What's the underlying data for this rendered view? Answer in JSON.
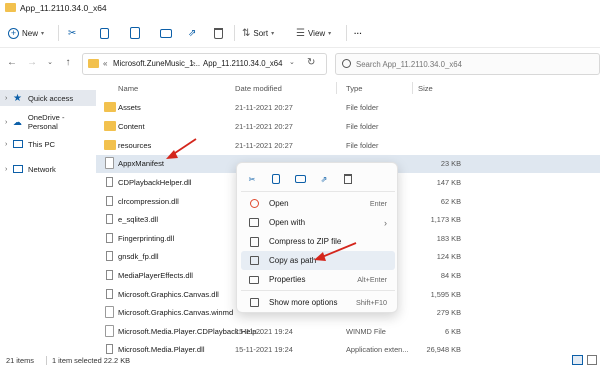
{
  "window": {
    "title": "App_11.2110.34.0_x64"
  },
  "toolbar": {
    "new_label": "New",
    "sort_label": "Sort",
    "view_label": "View",
    "more_label": "···"
  },
  "address": {
    "crumb_overflow": "«",
    "crumb1": "Microsoft.ZuneMusic_1...",
    "crumb_sep": ">",
    "crumb2": "App_11.2110.34.0_x64",
    "search_placeholder": "Search App_11.2110.34.0_x64"
  },
  "sidebar": {
    "items": [
      {
        "label": "Quick access"
      },
      {
        "label": "OneDrive - Personal"
      },
      {
        "label": "This PC"
      },
      {
        "label": "Network"
      }
    ]
  },
  "columns": {
    "name": "Name",
    "date": "Date modified",
    "type": "Type",
    "size": "Size"
  },
  "files": [
    {
      "name": "Assets",
      "date": "21-11-2021 20:27",
      "type": "File folder",
      "size": "",
      "kind": "folder"
    },
    {
      "name": "Content",
      "date": "21-11-2021 20:27",
      "type": "File folder",
      "size": "",
      "kind": "folder"
    },
    {
      "name": "resources",
      "date": "21-11-2021 20:27",
      "type": "File folder",
      "size": "",
      "kind": "folder"
    },
    {
      "name": "AppxManifest",
      "date": "",
      "type": "",
      "size": "23 KB",
      "kind": "file"
    },
    {
      "name": "CDPlaybackHelper.dll",
      "date": "",
      "type": "",
      "size": "147 KB",
      "kind": "dll"
    },
    {
      "name": "clrcompression.dll",
      "date": "",
      "type": "",
      "size": "62 KB",
      "kind": "dll"
    },
    {
      "name": "e_sqlite3.dll",
      "date": "",
      "type": "",
      "size": "1,173 KB",
      "kind": "dll"
    },
    {
      "name": "Fingerprinting.dll",
      "date": "",
      "type": "",
      "size": "183 KB",
      "kind": "dll"
    },
    {
      "name": "gnsdk_fp.dll",
      "date": "",
      "type": "",
      "size": "124 KB",
      "kind": "dll"
    },
    {
      "name": "MediaPlayerEffects.dll",
      "date": "",
      "type": "",
      "size": "84 KB",
      "kind": "dll"
    },
    {
      "name": "Microsoft.Graphics.Canvas.dll",
      "date": "",
      "type": "",
      "size": "1,595 KB",
      "kind": "dll"
    },
    {
      "name": "Microsoft.Graphics.Canvas.winmd",
      "date": "",
      "type": "",
      "size": "279 KB",
      "kind": "file"
    },
    {
      "name": "Microsoft.Media.Player.CDPlayback.Help...",
      "date": "15-11-2021 19:24",
      "type": "WINMD File",
      "size": "6 KB",
      "kind": "file"
    },
    {
      "name": "Microsoft.Media.Player.dll",
      "date": "15-11-2021 19:24",
      "type": "Application exten...",
      "size": "26,948 KB",
      "kind": "dll"
    }
  ],
  "context_menu": {
    "items": [
      {
        "label": "Open",
        "shortcut": "Enter",
        "icon": "O"
      },
      {
        "label": "Open with",
        "shortcut": "›",
        "icon": "▣"
      },
      {
        "label": "Compress to ZIP file",
        "shortcut": "",
        "icon": "▤"
      },
      {
        "label": "Copy as path",
        "shortcut": "",
        "icon": "⧉"
      },
      {
        "label": "Properties",
        "shortcut": "Alt+Enter",
        "icon": "🔧"
      },
      {
        "label": "Show more options",
        "shortcut": "Shift+F10",
        "icon": "⇱"
      }
    ]
  },
  "status": {
    "items_count": "21 items",
    "selected": "1 item selected  22.2 KB"
  },
  "colors": {
    "accent": "#0c5fa8",
    "arrow": "#d4261c",
    "folder": "#f2c14e",
    "selection": "#dfe7f0"
  }
}
